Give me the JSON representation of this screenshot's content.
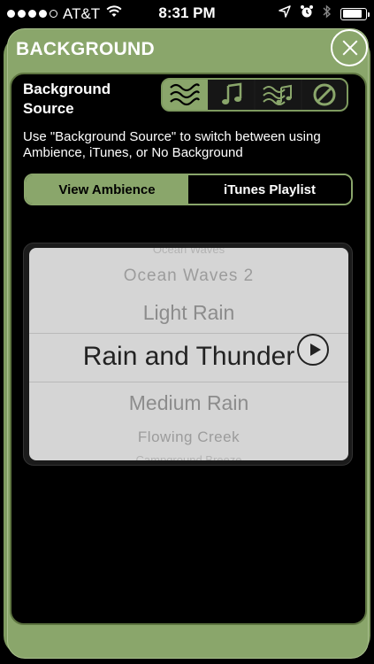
{
  "status_bar": {
    "signal_dots": [
      true,
      true,
      true,
      true,
      false
    ],
    "carrier": "AT&T",
    "wifi_icon": "wifi-icon",
    "time": "8:31 PM",
    "right_icons": [
      "location-arrow-icon",
      "alarm-clock-icon",
      "bluetooth-icon"
    ],
    "battery_level": 0.85
  },
  "panel": {
    "title": "BACKGROUND",
    "close_icon": "close-icon"
  },
  "background_source": {
    "label": "Background Source",
    "options": [
      {
        "icon": "ambience-waves-icon",
        "selected": true
      },
      {
        "icon": "music-note-icon",
        "selected": false
      },
      {
        "icon": "music-waves-icon",
        "selected": false
      },
      {
        "icon": "no-background-icon",
        "selected": false
      }
    ],
    "description": "Use \"Background Source\" to switch between using Ambience, iTunes, or No Background"
  },
  "view_toggle": {
    "view_ambience": "View Ambience",
    "itunes_playlist": "iTunes Playlist",
    "active": "view_ambience"
  },
  "picker": {
    "items": [
      "Ocean Waves",
      "Ocean Waves 2",
      "Light Rain",
      "Rain and Thunder",
      "Medium Rain",
      "Flowing Creek",
      "Campground Breeze"
    ],
    "selected": "Rain and Thunder",
    "play_icon": "play-icon"
  },
  "colors": {
    "accent_green": "#8aa66b",
    "picker_bg": "#d5d5d5"
  }
}
